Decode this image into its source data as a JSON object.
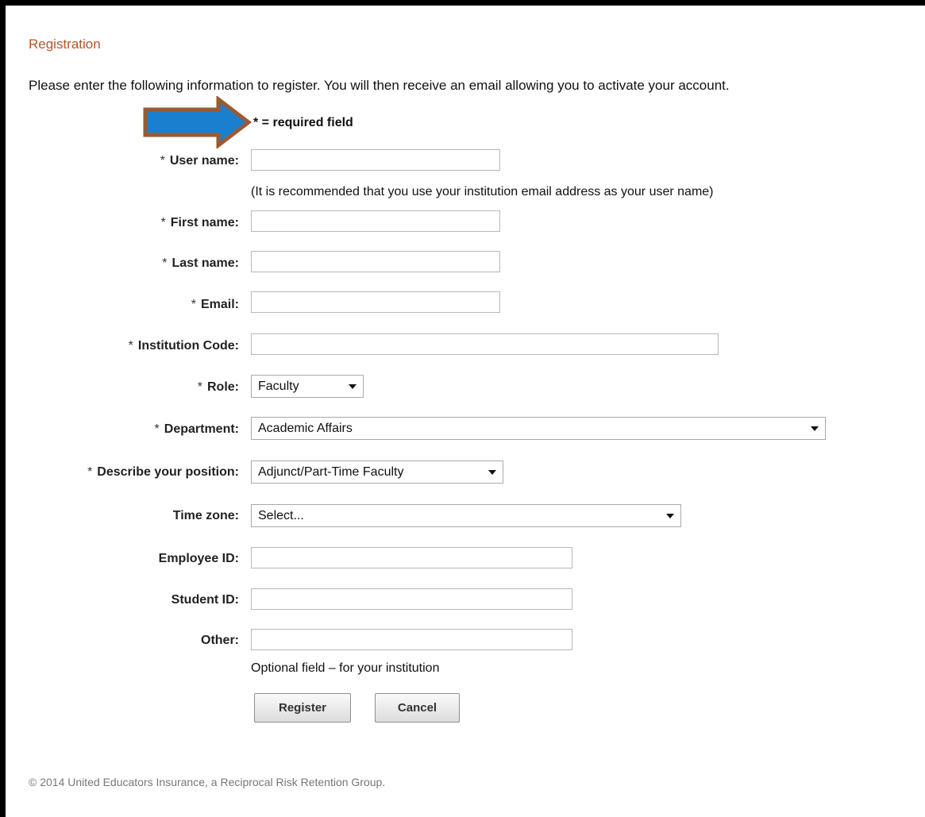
{
  "page": {
    "title": "Registration",
    "intro": "Please enter the following information to register. You will then receive an email allowing you to activate your account.",
    "required_note": "* = required field"
  },
  "form": {
    "username": {
      "star": "*",
      "label": "User name:",
      "value": "",
      "hint": "(It is recommended that you use your institution email address as your user name)"
    },
    "first_name": {
      "star": "*",
      "label": "First name:",
      "value": ""
    },
    "last_name": {
      "star": "*",
      "label": "Last name:",
      "value": ""
    },
    "email": {
      "star": "*",
      "label": "Email:",
      "value": ""
    },
    "institution_code": {
      "star": "*",
      "label": "Institution Code:",
      "value": ""
    },
    "role": {
      "star": "*",
      "label": "Role:",
      "selected": "Faculty"
    },
    "department": {
      "star": "*",
      "label": "Department:",
      "selected": "Academic Affairs"
    },
    "position": {
      "star": "*",
      "label": "Describe your position:",
      "selected": "Adjunct/Part-Time Faculty"
    },
    "time_zone": {
      "label": "Time zone:",
      "selected": "Select..."
    },
    "employee_id": {
      "label": "Employee ID:",
      "value": ""
    },
    "student_id": {
      "label": "Student ID:",
      "value": ""
    },
    "other": {
      "label": "Other:",
      "value": "",
      "hint": "Optional field – for your institution"
    }
  },
  "buttons": {
    "register": "Register",
    "cancel": "Cancel"
  },
  "footer": {
    "copyright": "© 2014 United Educators Insurance, a Reciprocal Risk Retention Group."
  },
  "colors": {
    "title": "#b5542b",
    "arrow_fill": "#1b7fd0",
    "arrow_stroke": "#9a5a32"
  },
  "icons": {
    "arrow": "right-arrow-annotation"
  }
}
